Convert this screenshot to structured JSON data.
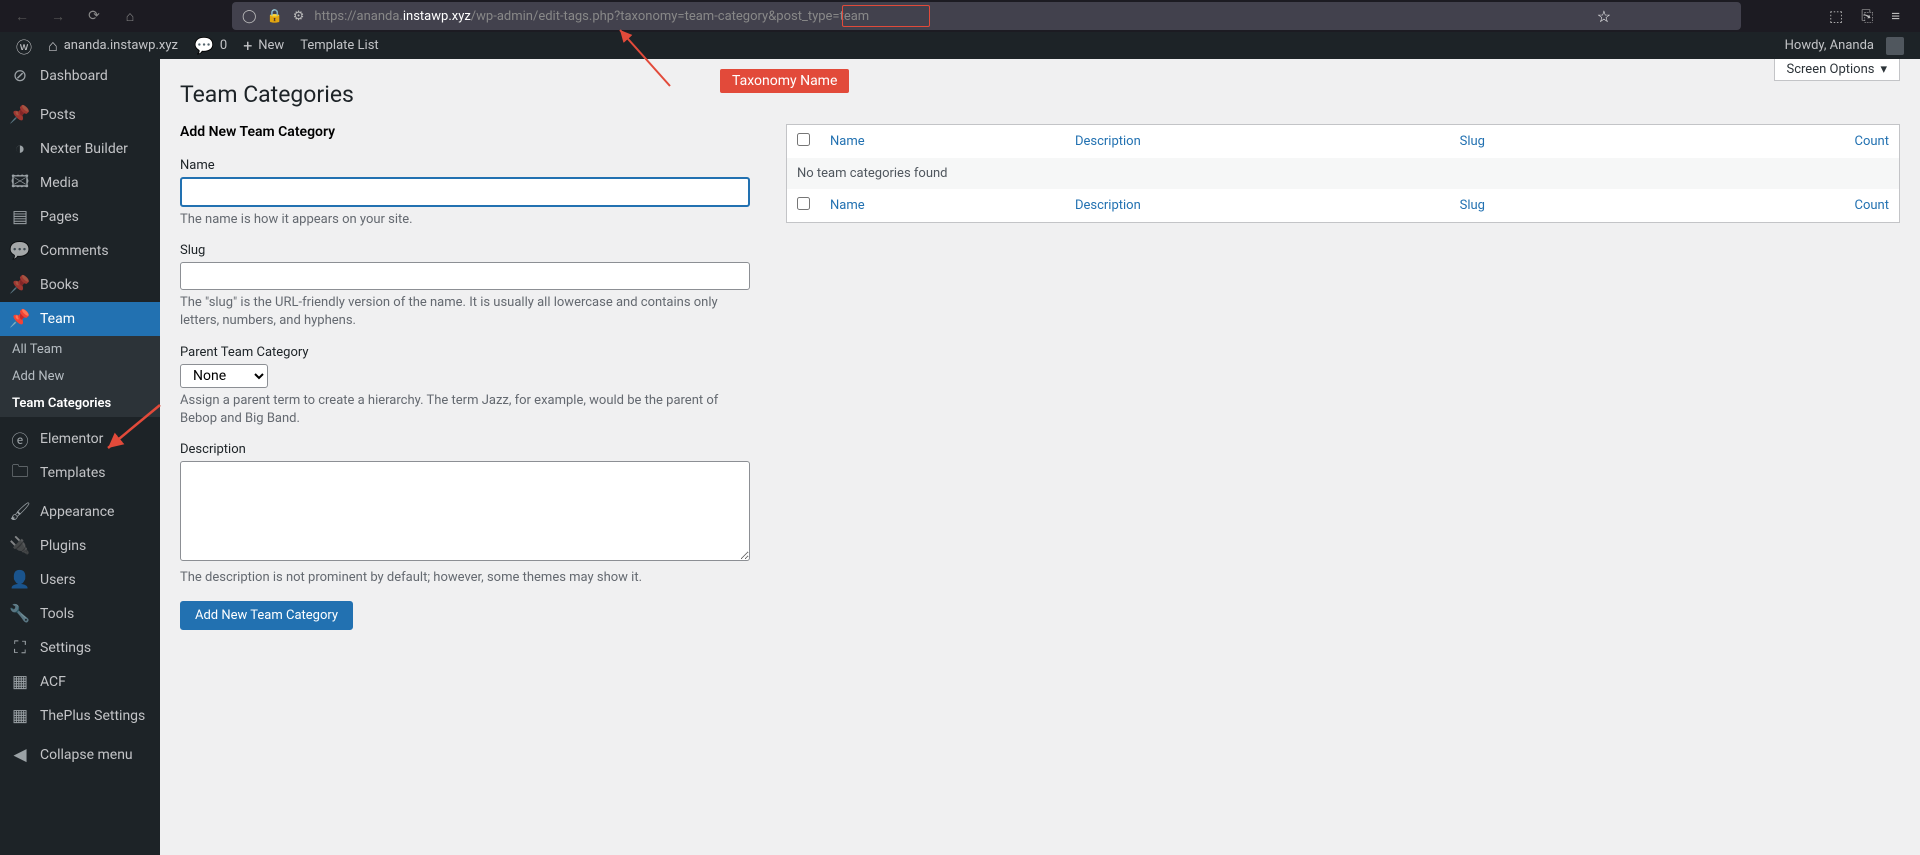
{
  "browser": {
    "url_prefix": "https://ananda.",
    "url_host": "instawp.xyz",
    "url_path1": "/wp-admin/edit-tags.php?taxonomy=",
    "url_highlight": "team-category",
    "url_path2": "&post_type=team"
  },
  "wp_bar": {
    "site": "ananda.instawp.xyz",
    "comments": "0",
    "new": "New",
    "template_list": "Template List",
    "howdy": "Howdy, Ananda"
  },
  "sidebar": {
    "dashboard": "Dashboard",
    "posts": "Posts",
    "nexter": "Nexter Builder",
    "media": "Media",
    "pages": "Pages",
    "comments": "Comments",
    "books": "Books",
    "team": "Team",
    "all_team": "All Team",
    "add_new": "Add New",
    "team_categories": "Team Categories",
    "elementor": "Elementor",
    "templates": "Templates",
    "appearance": "Appearance",
    "plugins": "Plugins",
    "users": "Users",
    "tools": "Tools",
    "settings": "Settings",
    "acf": "ACF",
    "theplus": "ThePlus Settings",
    "collapse": "Collapse menu"
  },
  "main": {
    "screen_options": "Screen Options",
    "page_title": "Team Categories",
    "add_new_heading": "Add New Team Category",
    "name_label": "Name",
    "name_help": "The name is how it appears on your site.",
    "slug_label": "Slug",
    "slug_help": "The \"slug\" is the URL-friendly version of the name. It is usually all lowercase and contains only letters, numbers, and hyphens.",
    "parent_label": "Parent Team Category",
    "parent_none": "None",
    "parent_help": "Assign a parent term to create a hierarchy. The term Jazz, for example, would be the parent of Bebop and Big Band.",
    "desc_label": "Description",
    "desc_help": "The description is not prominent by default; however, some themes may show it.",
    "submit": "Add New Team Category"
  },
  "table": {
    "col_name": "Name",
    "col_desc": "Description",
    "col_slug": "Slug",
    "col_count": "Count",
    "empty": "No team categories found"
  },
  "annotation": {
    "label": "Taxonomy Name"
  }
}
